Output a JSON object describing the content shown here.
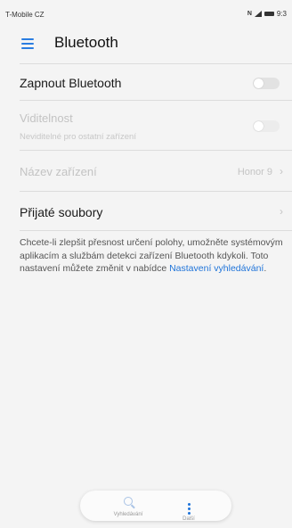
{
  "status": {
    "carrier": "T-Mobile CZ",
    "nfc": "N",
    "time": "9:3"
  },
  "appbar": {
    "title": "Bluetooth"
  },
  "settings": {
    "bluetooth_toggle": {
      "label": "Zapnout Bluetooth",
      "on": false
    },
    "visibility": {
      "label": "Viditelnost",
      "sub": "Neviditelné pro ostatní zařízení",
      "on": false
    },
    "device_name": {
      "label": "Název zařízení",
      "value": "Honor 9"
    },
    "received_files": {
      "label": "Přijaté soubory"
    }
  },
  "info": {
    "text": "Chcete-li zlepšit přesnost určení polohy, umožněte systémovým aplikacím a službám detekci zařízení Bluetooth kdykoli. Toto nastavení můžete změnit v nabídce ",
    "link": "Nastavení vyhledávání",
    "end": "."
  },
  "bottom": {
    "search_label": "Vyhledávání",
    "more_label": "Další"
  },
  "colors": {
    "accent": "#1e73d9",
    "background": "#f4f4f4"
  }
}
